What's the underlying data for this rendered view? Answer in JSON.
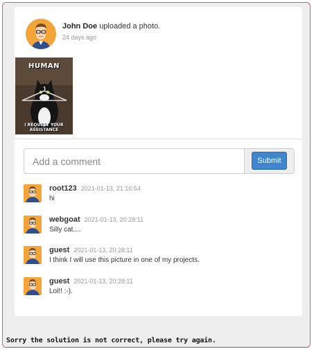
{
  "post": {
    "author": "John Doe",
    "action": "uploaded a photo.",
    "time": "24 days ago",
    "photo_caption_top": "HUMAN",
    "photo_caption_bottom_1": "I REQUEST YOUR",
    "photo_caption_bottom_2": "ASSISTANCE"
  },
  "comment_form": {
    "placeholder": "Add a comment",
    "submit_label": "Submit"
  },
  "comments": [
    {
      "user": "root123",
      "date": "2021-01-13, 21:16:54",
      "text": "hi"
    },
    {
      "user": "webgoat",
      "date": "2021-01-13, 20:28:11",
      "text": "Silly cat...."
    },
    {
      "user": "guest",
      "date": "2021-01-13, 20:28:11",
      "text": "I think I will use this picture in one of my projects."
    },
    {
      "user": "guest",
      "date": "2021-01-13, 20:28:11",
      "text": "Lol!! :-)."
    }
  ],
  "status_message": "Sorry the solution is not correct, please try again.",
  "colors": {
    "accent": "#3f86cf",
    "avatar_bg": "#f3a53a",
    "frame_border": "#c46a6a"
  },
  "icons": {
    "avatar": "cartoon-man-glasses-icon"
  }
}
